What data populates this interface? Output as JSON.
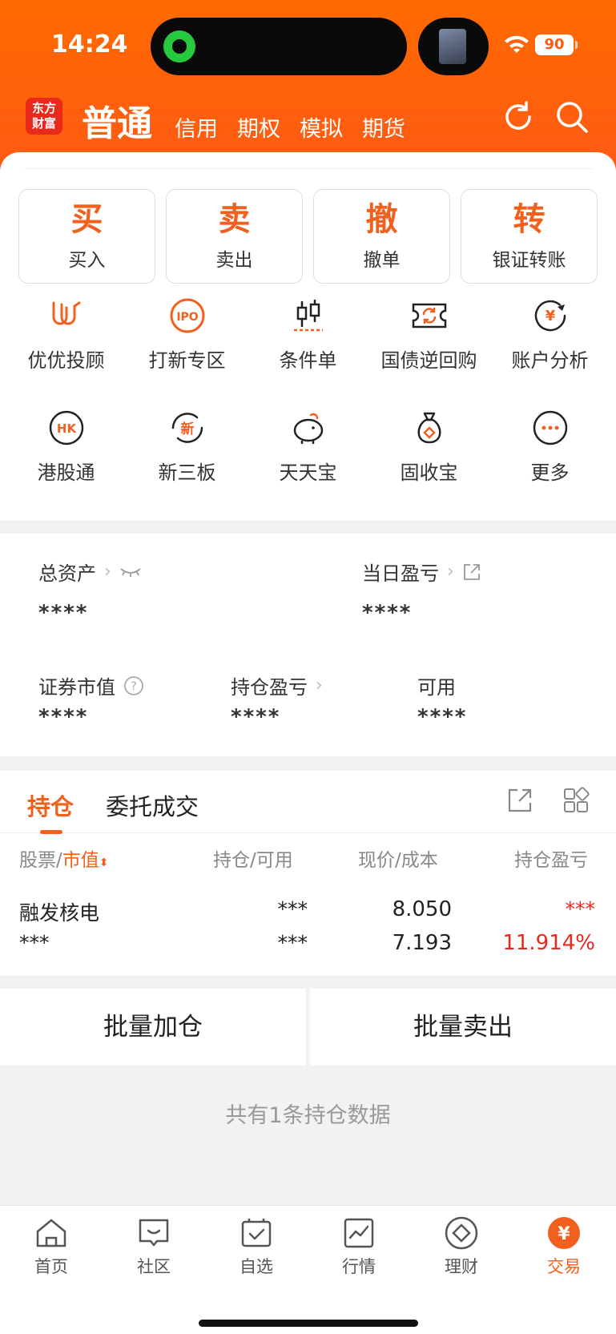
{
  "status_bar": {
    "time": "14:24",
    "battery": "90"
  },
  "header": {
    "logo_text": "东方财富",
    "tabs": [
      {
        "label": "普通",
        "active": true
      },
      {
        "label": "信用"
      },
      {
        "label": "期权"
      },
      {
        "label": "模拟"
      },
      {
        "label": "期货"
      }
    ],
    "icons": [
      "refresh-icon",
      "search-icon"
    ]
  },
  "trade_buttons": [
    {
      "big": "买",
      "small": "买入"
    },
    {
      "big": "卖",
      "small": "卖出"
    },
    {
      "big": "撤",
      "small": "撤单"
    },
    {
      "big": "转",
      "small": "银证转账"
    }
  ],
  "services": [
    {
      "label": "优优投顾",
      "icon": "uu-advisor-icon"
    },
    {
      "label": "打新专区",
      "icon": "ipo-icon"
    },
    {
      "label": "条件单",
      "icon": "condition-order-icon"
    },
    {
      "label": "国债逆回购",
      "icon": "reverse-repo-icon"
    },
    {
      "label": "账户分析",
      "icon": "account-analysis-icon"
    },
    {
      "label": "港股通",
      "icon": "hk-connect-icon"
    },
    {
      "label": "新三板",
      "icon": "neeq-icon"
    },
    {
      "label": "天天宝",
      "icon": "piggy-bank-icon"
    },
    {
      "label": "固收宝",
      "icon": "money-bag-icon"
    },
    {
      "label": "更多",
      "icon": "more-icon"
    }
  ],
  "assets": {
    "total_label": "总资产",
    "total_value": "****",
    "daily_label": "当日盈亏",
    "daily_value": "****",
    "market_label": "证券市值",
    "market_value": "****",
    "holding_pl_label": "持仓盈亏",
    "holding_pl_value": "****",
    "available_label": "可用",
    "available_value": "****"
  },
  "positions": {
    "tabs": [
      {
        "label": "持仓",
        "active": true
      },
      {
        "label": "委托成交"
      }
    ],
    "columns": {
      "stock": "股票",
      "sep": "/",
      "sort_field": "市值",
      "holding": "持仓/可用",
      "price": "现价/成本",
      "pl": "持仓盈亏"
    },
    "rows": [
      {
        "name": "融发核电",
        "market_value": "***",
        "holding": "***",
        "available": "***",
        "price": "8.050",
        "cost": "7.193",
        "pl": "***",
        "pl_pct": "11.914%"
      }
    ]
  },
  "actions": {
    "add": "批量加仓",
    "sell": "批量卖出"
  },
  "count_text": "共有1条持仓数据",
  "tabbar": [
    {
      "label": "首页",
      "icon": "home-icon"
    },
    {
      "label": "社区",
      "icon": "community-icon"
    },
    {
      "label": "自选",
      "icon": "watchlist-icon"
    },
    {
      "label": "行情",
      "icon": "market-icon"
    },
    {
      "label": "理财",
      "icon": "wealth-icon"
    },
    {
      "label": "交易",
      "icon": "trade-icon",
      "active": true
    }
  ],
  "colors": {
    "accent": "#f2601e",
    "header": "#ff5a14",
    "loss_red": "#e8291c"
  }
}
